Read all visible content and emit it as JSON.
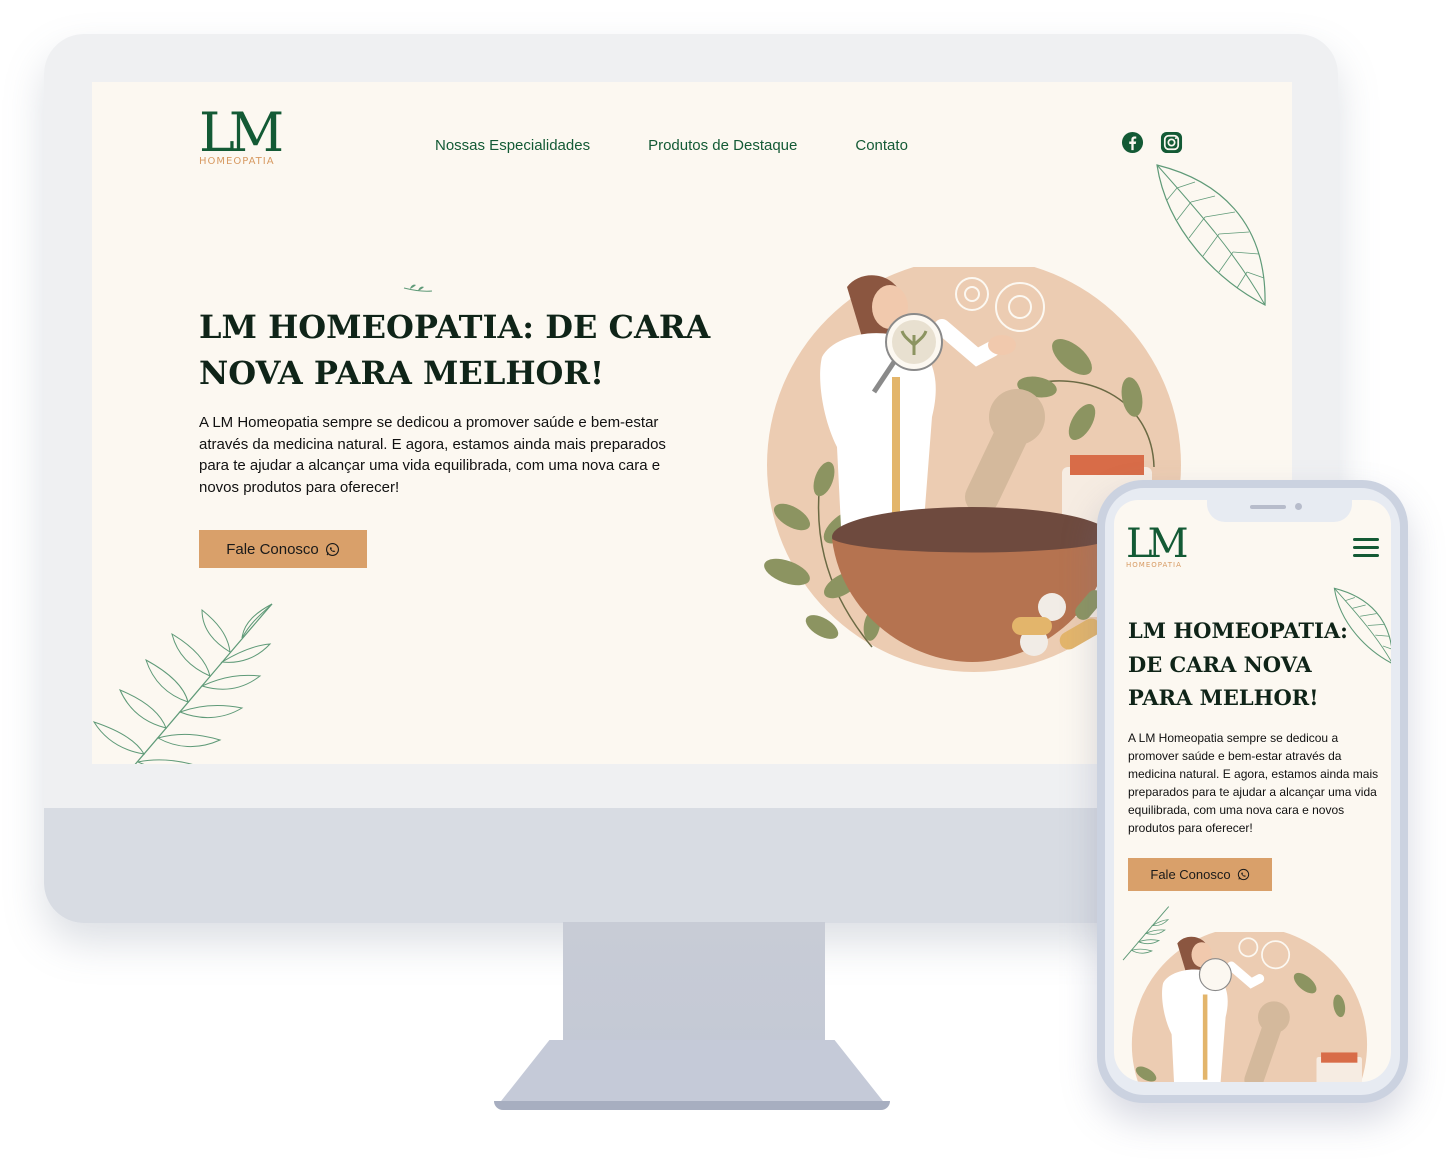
{
  "brand": {
    "logo_text": "LM",
    "logo_subtitle": "HOMEOPATIA"
  },
  "nav": {
    "items": [
      {
        "label": "Nossas Especialidades"
      },
      {
        "label": "Produtos de Destaque"
      },
      {
        "label": "Contato"
      }
    ]
  },
  "social": {
    "icons": [
      "facebook-icon",
      "instagram-icon"
    ]
  },
  "hero": {
    "title": "LM HOMEOPATIA: DE CARA NOVA PARA MELHOR!",
    "text": "A LM Homeopatia sempre se dedicou a promover saúde e bem-estar através da medicina natural. E agora, estamos ainda mais preparados para te ajudar a alcançar uma vida equilibrada, com uma nova cara e novos produtos para oferecer!",
    "cta_label": "Fale Conosco",
    "cta_icon": "whatsapp-icon"
  },
  "colors": {
    "brand_green": "#135a35",
    "accent_orange": "#d9a06a",
    "page_background": "#fcf8f1",
    "heading_text": "#0f2418"
  }
}
